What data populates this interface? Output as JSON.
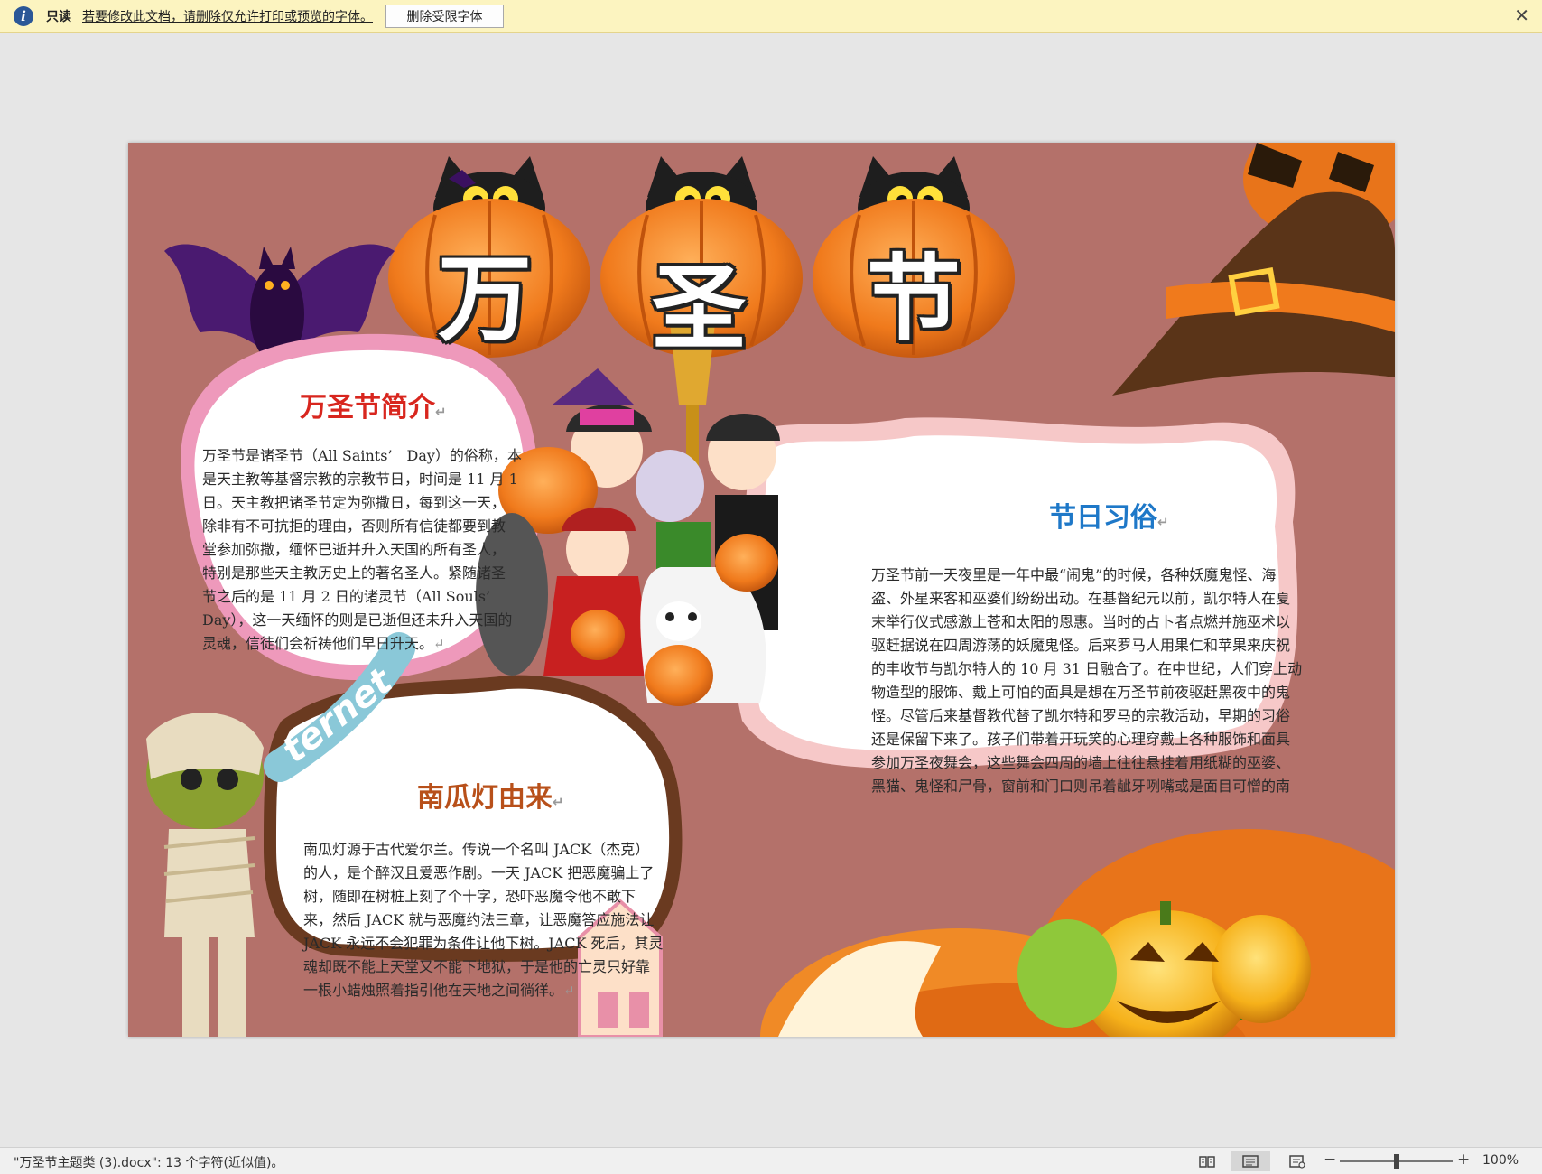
{
  "infobar": {
    "label": "只读",
    "message": "若要修改此文档，请删除仅允许打印或预览的字体。",
    "button": "删除受限字体",
    "close": "✕"
  },
  "doc": {
    "big_title_chars": [
      "万",
      "圣",
      "节"
    ],
    "internet_word": "ternet",
    "intro": {
      "title": "万圣节简介",
      "lines": [
        "万圣节是诸圣节（All Saints’　Day）的俗称，本",
        "是天主教等基督宗教的宗教节日，时间是 11 月 1",
        "日。天主教把诸圣节定为弥撒日，每到这一天，",
        "除非有不可抗拒的理由，否则所有信徒都要到教",
        "堂参加弥撒，缅怀已逝并升入天国的所有圣人，",
        "特别是那些天主教历史上的著名圣人。紧随诸圣",
        "节之后的是 11 月 2 日的诸灵节（All Souls’",
        "Day），这一天缅怀的则是已逝但还未升入天国的",
        "灵魂，信徒们会祈祷他们早日升天。"
      ]
    },
    "customs": {
      "title": "节日习俗",
      "lines": [
        "万圣节前一天夜里是一年中最“闹鬼”的时候，各种妖魔鬼怪、海",
        "盗、外星来客和巫婆们纷纷出动。在基督纪元以前，凯尔特人在夏",
        "末举行仪式感激上苍和太阳的恩惠。当时的占卜者点燃并施巫术以",
        "驱赶据说在四周游荡的妖魔鬼怪。后来罗马人用果仁和苹果来庆祝",
        "的丰收节与凯尔特人的 10 月 31 日融合了。在中世纪，人们穿上动",
        "物造型的服饰、戴上可怕的面具是想在万圣节前夜驱赶黑夜中的鬼",
        "怪。尽管后来基督教代替了凯尔特和罗马的宗教活动，早期的习俗",
        "还是保留下来了。孩子们带着开玩笑的心理穿戴上各种服饰和面具",
        "参加万圣夜舞会，这些舞会四周的墙上往往悬挂着用纸糊的巫婆、",
        "黑猫、鬼怪和尸骨，窗前和门口则吊着龇牙咧嘴或是面目可憎的南"
      ]
    },
    "lantern": {
      "title": "南瓜灯由来",
      "lines": [
        "南瓜灯源于古代爱尔兰。传说一个名叫 JACK（杰克）",
        "的人，是个醉汉且爱恶作剧。一天 JACK 把恶魔骗上了",
        "树，随即在树桩上刻了个十字，恐吓恶魔令他不敢下",
        "来，然后 JACK 就与恶魔约法三章，让恶魔答应施法让",
        "JACK 永远不会犯罪为条件让他下树。JACK 死后，其灵",
        "魂却既不能上天堂又不能下地狱，于是他的亡灵只好靠",
        "一根小蜡烛照着指引他在天地之间徜徉。"
      ]
    },
    "paragraph_mark": "↵"
  },
  "status": {
    "text": "\"万圣节主题类 (3).docx\": 13 个字符(近似值)。",
    "zoom_minus": "−",
    "zoom_plus": "+",
    "zoom_level": "100%",
    "zoom_fraction": 0.5
  },
  "colors": {
    "page_bg": "#b4716a",
    "intro_title": "#d8261e",
    "customs_title": "#1e78c8",
    "lantern_title": "#b8501a"
  }
}
